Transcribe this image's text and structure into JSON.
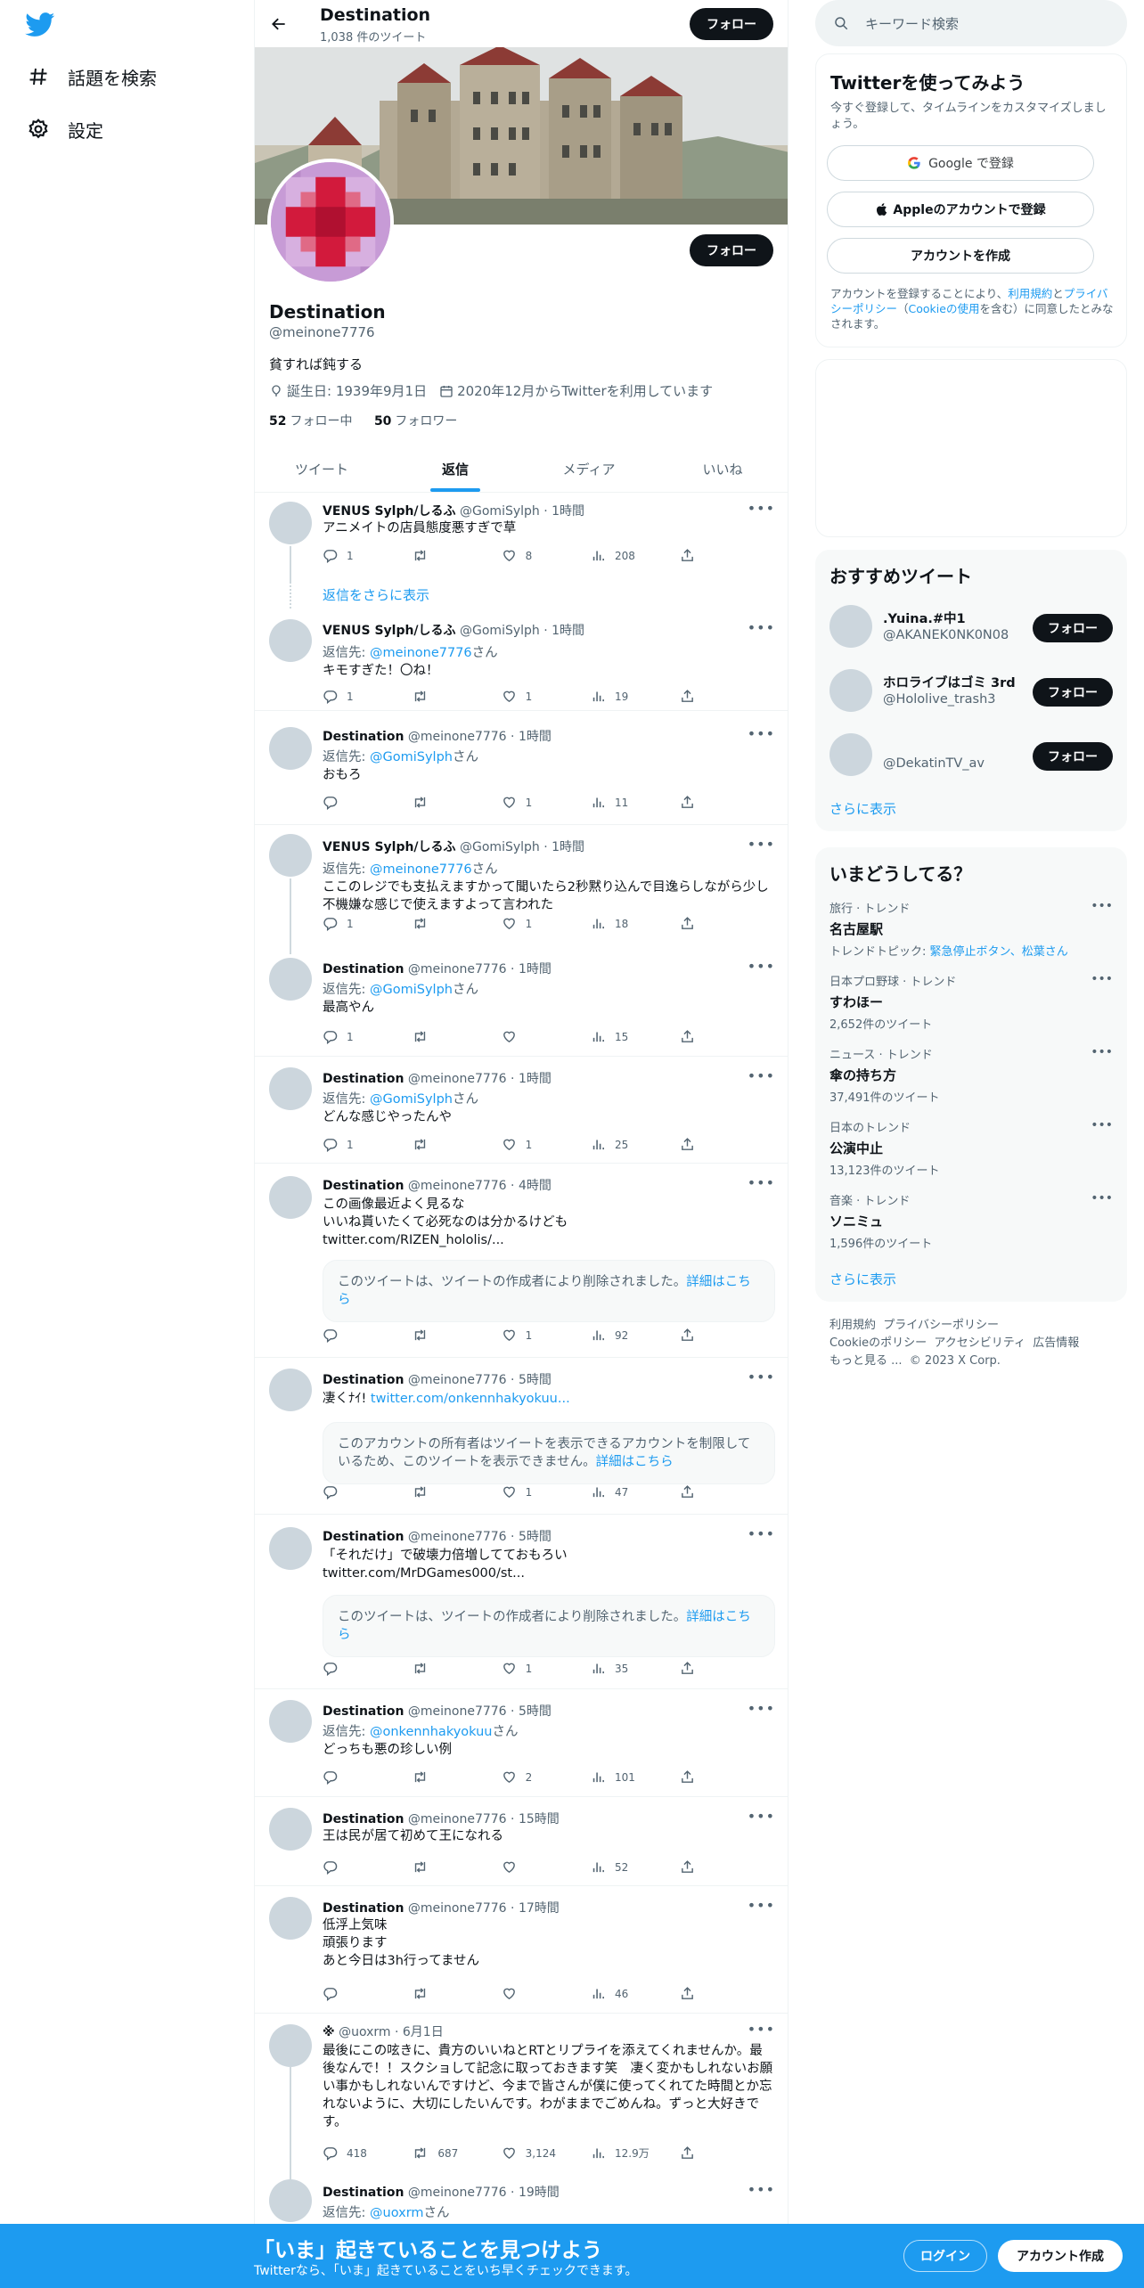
{
  "nav": {
    "explore": "話題を検索",
    "settings": "設定"
  },
  "header": {
    "name": "Destination",
    "tweet_count": "1,038 件のツイート",
    "follow": "フォロー"
  },
  "profile": {
    "name": "Destination",
    "handle": "@meinone7776",
    "bio": "貧すれば鈍する",
    "birthday": "誕生日: 1939年9月1日",
    "joined": "2020年12月からTwitterを利用しています",
    "following_count": "52",
    "following_label": "フォロー中",
    "followers_count": "50",
    "followers_label": "フォロワー",
    "follow": "フォロー"
  },
  "tabs": [
    "ツイート",
    "返信",
    "メディア",
    "いいね"
  ],
  "show_more_replies": "返信をさらに表示",
  "tweets": [
    {
      "name": "VENUS Sylph/しるふ",
      "handle": "@GomiSylph",
      "time": "· 1時間",
      "text": "アニメイトの店員態度悪すぎで草",
      "reply": "",
      "reply_user": "",
      "reply_suffix": "",
      "link": "",
      "quote": "",
      "quote_link": "",
      "stats": [
        "1",
        "",
        "8",
        "208"
      ]
    },
    {
      "name": "VENUS Sylph/しるふ",
      "handle": "@GomiSylph",
      "time": "· 1時間",
      "text": "キモすぎた！〇ね！",
      "reply": "返信先: ",
      "reply_user": "@meinone7776",
      "reply_suffix": "さん",
      "link": "",
      "quote": "",
      "quote_link": "",
      "stats": [
        "1",
        "",
        "1",
        "19"
      ]
    },
    {
      "name": "Destination",
      "handle": "@meinone7776",
      "time": "· 1時間",
      "text": "おもろ",
      "reply": "返信先: ",
      "reply_user": "@GomiSylph",
      "reply_suffix": "さん",
      "link": "",
      "quote": "",
      "quote_link": "",
      "stats": [
        "",
        "",
        "1",
        "11"
      ]
    },
    {
      "name": "VENUS Sylph/しるふ",
      "handle": "@GomiSylph",
      "time": "· 1時間",
      "text": "ここのレジでも支払えますかって聞いたら2秒黙り込んで目逸らしながら少し不機嫌な感じで使えますよって言われた",
      "reply": "返信先: ",
      "reply_user": "@meinone7776",
      "reply_suffix": "さん",
      "link": "",
      "quote": "",
      "quote_link": "",
      "stats": [
        "1",
        "",
        "1",
        "18"
      ]
    },
    {
      "name": "Destination",
      "handle": "@meinone7776",
      "time": "· 1時間",
      "text": "最高やん",
      "reply": "返信先: ",
      "reply_user": "@GomiSylph",
      "reply_suffix": "さん",
      "link": "",
      "quote": "",
      "quote_link": "",
      "stats": [
        "1",
        "",
        "",
        "15"
      ]
    },
    {
      "name": "Destination",
      "handle": "@meinone7776",
      "time": "· 1時間",
      "text": "どんな感じやったんや",
      "reply": "返信先: ",
      "reply_user": "@GomiSylph",
      "reply_suffix": "さん",
      "link": "",
      "quote": "",
      "quote_link": "",
      "stats": [
        "1",
        "",
        "1",
        "25"
      ]
    },
    {
      "name": "Destination",
      "handle": "@meinone7776",
      "time": "· 4時間",
      "text": "この画像最近よく見るな\nいいね貰いたくて必死なのは分かるけども",
      "reply": "",
      "reply_user": "",
      "reply_suffix": "",
      "link": "twitter.com/RIZEN_hololis/...",
      "quote": "このツイートは、ツイートの作成者により削除されました。",
      "quote_link": "詳細はこちら",
      "stats": [
        "",
        "",
        "1",
        "92"
      ]
    },
    {
      "name": "Destination",
      "handle": "@meinone7776",
      "time": "· 5時間",
      "text": "凄くﾅｲ! ",
      "reply": "",
      "reply_user": "",
      "reply_suffix": "",
      "link": "twitter.com/onkennhakyokuu...",
      "quote": "このアカウントの所有者はツイートを表示できるアカウントを制限しているため、このツイートを表示できません。",
      "quote_link": "詳細はこちら",
      "stats": [
        "",
        "",
        "1",
        "47"
      ]
    },
    {
      "name": "Destination",
      "handle": "@meinone7776",
      "time": "· 5時間",
      "text": "「それだけ」で破壊力倍増してておもろい",
      "reply": "",
      "reply_user": "",
      "reply_suffix": "",
      "link": "twitter.com/MrDGames000/st...",
      "quote": "このツイートは、ツイートの作成者により削除されました。",
      "quote_link": "詳細はこちら",
      "stats": [
        "",
        "",
        "1",
        "35"
      ]
    },
    {
      "name": "Destination",
      "handle": "@meinone7776",
      "time": "· 5時間",
      "text": "どっちも悪の珍しい例",
      "reply": "返信先: ",
      "reply_user": "@onkennhakyokuu",
      "reply_suffix": "さん",
      "link": "",
      "quote": "",
      "quote_link": "",
      "stats": [
        "",
        "",
        "2",
        "101"
      ]
    },
    {
      "name": "Destination",
      "handle": "@meinone7776",
      "time": "· 15時間",
      "text": "王は民が居て初めて王になれる",
      "reply": "",
      "reply_user": "",
      "reply_suffix": "",
      "link": "",
      "quote": "",
      "quote_link": "",
      "stats": [
        "",
        "",
        "",
        "52"
      ]
    },
    {
      "name": "Destination",
      "handle": "@meinone7776",
      "time": "· 17時間",
      "text": "低浮上気味\n頑張ります\nあと今日は3h行ってません",
      "reply": "",
      "reply_user": "",
      "reply_suffix": "",
      "link": "",
      "quote": "",
      "quote_link": "",
      "stats": [
        "",
        "",
        "",
        "46"
      ]
    },
    {
      "name": "※",
      "handle": "@uoxrm",
      "time": "· 6月1日",
      "text": "最後にこの呟きに、貴方のいいねとRTとリプライを添えてくれませんか。最後なんで！！スクショして記念に取っておきます笑　凄く変かもしれないお願い事かもしれないんですけど、今まで皆さんが僕に使ってくれてた時間とか忘れないように、大切にしたいんです。わがままでごめんね。ずっと大好きです。",
      "reply": "",
      "reply_user": "",
      "reply_suffix": "",
      "link": "",
      "quote": "",
      "quote_link": "",
      "stats": [
        "418",
        "687",
        "3,124",
        "12.9万"
      ]
    },
    {
      "name": "Destination",
      "handle": "@meinone7776",
      "time": "· 19時間",
      "text": "",
      "reply": "返信先: ",
      "reply_user": "@uoxrm",
      "reply_suffix": "さん",
      "link": "",
      "quote": "",
      "quote_link": "",
      "stats": [
        "",
        "",
        "",
        ""
      ]
    }
  ],
  "right": {
    "search_placeholder": "キーワード検索",
    "signup_title": "Twitterを使ってみよう",
    "signup_sub": "今すぐ登録して、タイムラインをカスタマイズしましょう。",
    "google_btn": "Google で登録",
    "apple_btn": "Appleのアカウントで登録",
    "create_btn": "アカウントを作成",
    "terms_prefix": "アカウントを登録することにより、",
    "terms_link": "利用規約",
    "terms_mid": "と",
    "privacy_link": "プライバシーポリシー",
    "cookie_prefix": "（",
    "cookie_link": "Cookieの使用",
    "terms_suffix": "を含む）に同意したとみなされます。",
    "reco_title": "おすすめツイート",
    "reco": [
      {
        "name": ".Yuina.#中1",
        "handle": "@AKANEK0NK0N08"
      },
      {
        "name": "ホロライブはゴミ 3rd",
        "handle": "@Hololive_trash3"
      },
      {
        "name": "",
        "handle": "@DekatinTV_av"
      }
    ],
    "follow": "フォロー",
    "show_more": "さらに表示",
    "trend_title": "いまどうしてる？",
    "trends": [
      {
        "cat": "旅行 · トレンド",
        "title": "名古屋駅",
        "extra_prefix": "トレンドトピック: ",
        "extra_links": "緊急停止ボタン、松葉さん",
        "count": ""
      },
      {
        "cat": "日本プロ野球 · トレンド",
        "title": "すわほー",
        "extra_prefix": "",
        "extra_links": "",
        "count": "2,652件のツイート"
      },
      {
        "cat": "ニュース · トレンド",
        "title": "傘の持ち方",
        "extra_prefix": "",
        "extra_links": "",
        "count": "37,491件のツイート"
      },
      {
        "cat": "日本のトレンド",
        "title": "公演中止",
        "extra_prefix": "",
        "extra_links": "",
        "count": "13,123件のツイート"
      },
      {
        "cat": "音楽 · トレンド",
        "title": "ソニミュ",
        "extra_prefix": "",
        "extra_links": "",
        "count": "1,596件のツイート"
      }
    ],
    "footer": {
      "line1a": "利用規約",
      "line1b": "プライバシーポリシー",
      "line2a": "Cookieのポリシー",
      "line2b": "アクセシビリティ",
      "line2c": "広告情報",
      "line3a": "もっと見る ...",
      "line3b": "© 2023 X Corp."
    }
  },
  "bottom": {
    "title": "「いま」起きていることを見つけよう",
    "sub": "Twitterなら、「いま」起きていることをいち早くチェックできます。",
    "login": "ログイン",
    "signup": "アカウント作成"
  }
}
